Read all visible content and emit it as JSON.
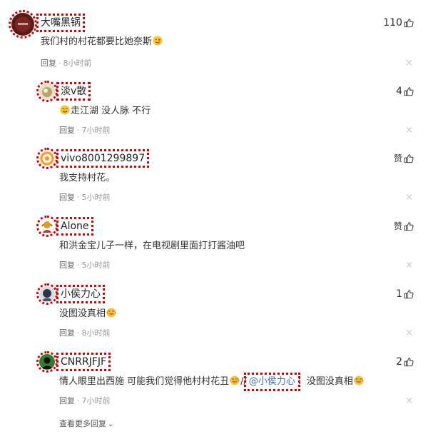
{
  "comments": [
    {
      "username": "大嘴黑锅",
      "likes": "110",
      "text": "我们村的村花都要比她奈斯",
      "emoji": "tongue-out-emoji",
      "time": "8小时前",
      "avatar_color": "#5a1a1a"
    },
    {
      "username": "淡v散",
      "likes": "4",
      "text": "走江湖 没人脉 不行",
      "emoji": "smile-emoji",
      "time": "7小时前"
    },
    {
      "username": "vivo8001299897",
      "likes": "赞",
      "text": "我支持村花。",
      "time": "5小时前"
    },
    {
      "username": "Alone",
      "likes": "赞",
      "text": "和洪金宝儿子一样，在电视剧里面打打酱油吧",
      "time": "5小时前"
    },
    {
      "username": "小侯力心",
      "likes": "1",
      "text": "没图没真相",
      "emoji": "laugh-cry-emoji",
      "time": "8小时前"
    },
    {
      "username": "CNRRJFJF",
      "likes": "2",
      "text_before": "情人眼里出西施 可能我们觉得他村村花丑",
      "separator": "//",
      "mention": "@小侯力心",
      "text_after": "：没图没真相",
      "time": "7小时前"
    }
  ],
  "labels": {
    "reply": "回复",
    "dot": "·",
    "close": "×",
    "more_replies": "查看更多回复"
  },
  "colors": {
    "mention": "#3b6fb6",
    "annotation": "#d40000",
    "meta": "#999999"
  }
}
